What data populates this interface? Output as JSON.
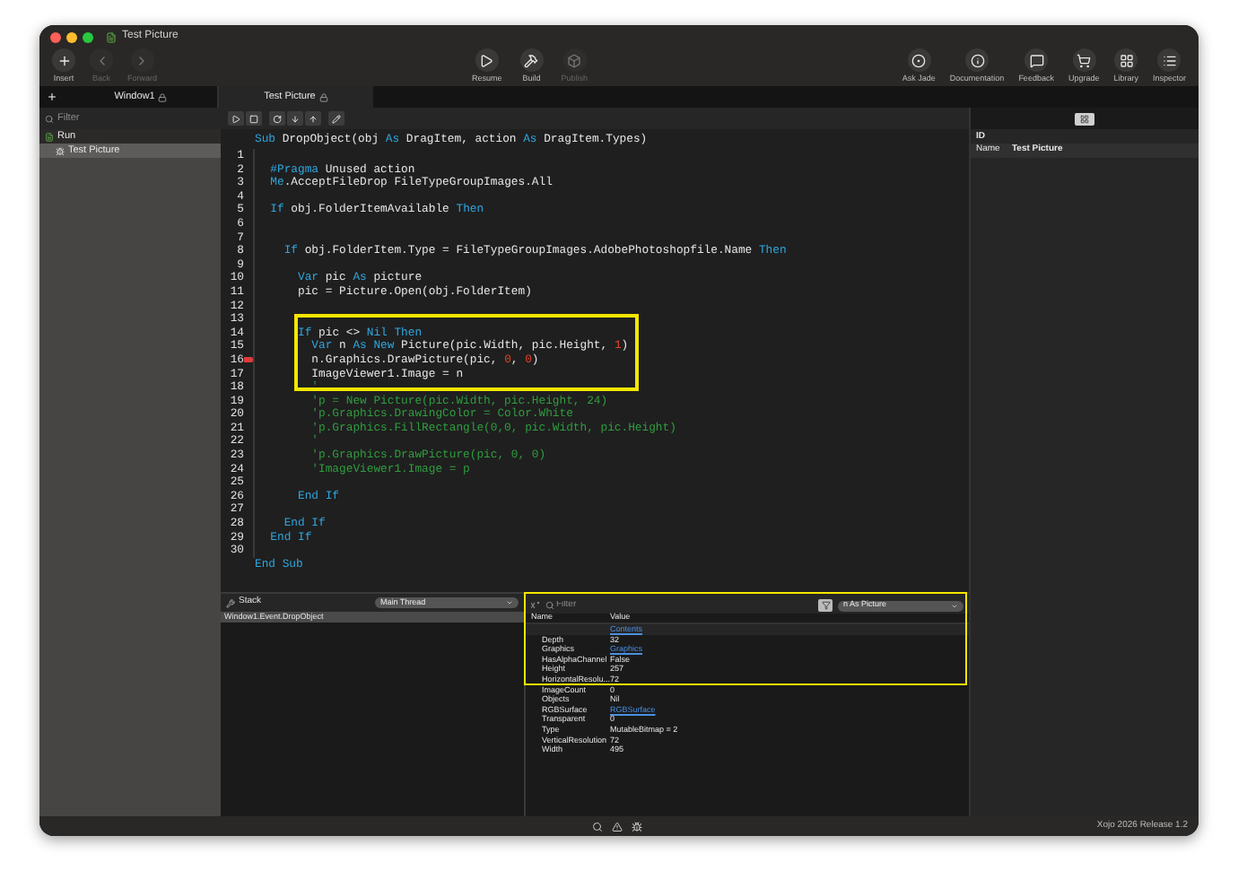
{
  "window": {
    "title": "Test Picture"
  },
  "toolbar": {
    "left": [
      {
        "label": "Insert",
        "kind": "insert",
        "disabled": false
      },
      {
        "label": "Back",
        "kind": "back",
        "disabled": true
      },
      {
        "label": "Forward",
        "kind": "forward",
        "disabled": true
      }
    ],
    "center": [
      {
        "label": "Resume",
        "kind": "resume",
        "disabled": false
      },
      {
        "label": "Build",
        "kind": "build",
        "disabled": false
      },
      {
        "label": "Publish",
        "kind": "publish",
        "disabled": true
      }
    ],
    "right": [
      {
        "label": "Ask Jade",
        "kind": "ask",
        "disabled": false
      },
      {
        "label": "Documentation",
        "kind": "docs",
        "disabled": false
      },
      {
        "label": "Feedback",
        "kind": "feedback",
        "disabled": false
      },
      {
        "label": "Upgrade",
        "kind": "upgrade",
        "disabled": false
      },
      {
        "label": "Library",
        "kind": "library",
        "disabled": false
      },
      {
        "label": "Inspector",
        "kind": "inspector",
        "disabled": false
      }
    ]
  },
  "tabs": [
    {
      "label": "Window1",
      "selected": false
    },
    {
      "label": "Test Picture",
      "selected": true
    }
  ],
  "sidebar": {
    "filter": {
      "placeholder": "Filter"
    },
    "items": [
      {
        "label": "Run",
        "selected": false,
        "children": [
          {
            "label": "Test Picture",
            "selected": true
          }
        ]
      }
    ]
  },
  "editor": {
    "header": [
      {
        "kind": "kw",
        "text": "Sub"
      },
      {
        "kind": "text",
        "text": " DropObject(obj "
      },
      {
        "kind": "kw",
        "text": "As"
      },
      {
        "kind": "text",
        "text": " DragItem, action "
      },
      {
        "kind": "kw",
        "text": "As"
      },
      {
        "kind": "text",
        "text": " DragItem.Types)"
      }
    ],
    "lines": [
      {
        "number": "1",
        "breakpoint": false
      },
      {
        "number": "2",
        "breakpoint": false,
        "segments": [
          {
            "kind": "kw",
            "text": "  #Pragma"
          },
          {
            "kind": "text",
            "text": " Unused action"
          }
        ]
      },
      {
        "number": "3",
        "breakpoint": false,
        "segments": [
          {
            "kind": "kw",
            "text": "  Me"
          },
          {
            "kind": "text",
            "text": ".AcceptFileDrop FileTypeGroupImages.All"
          }
        ]
      },
      {
        "number": "4",
        "breakpoint": false
      },
      {
        "number": "5",
        "breakpoint": false,
        "segments": [
          {
            "kind": "kw",
            "text": "  If"
          },
          {
            "kind": "text",
            "text": " obj.FolderItemAvailable "
          },
          {
            "kind": "kw",
            "text": "Then"
          }
        ]
      },
      {
        "number": "6",
        "breakpoint": false
      },
      {
        "number": "7",
        "breakpoint": false
      },
      {
        "number": "8",
        "breakpoint": false,
        "segments": [
          {
            "kind": "kw",
            "text": "    If"
          },
          {
            "kind": "text",
            "text": " obj.FolderItem.Type = FileTypeGroupImages.AdobePhotoshopfile.Name "
          },
          {
            "kind": "kw",
            "text": "Then"
          }
        ]
      },
      {
        "number": "9",
        "breakpoint": false
      },
      {
        "number": "10",
        "breakpoint": false,
        "segments": [
          {
            "kind": "kw",
            "text": "      Var"
          },
          {
            "kind": "text",
            "text": " pic "
          },
          {
            "kind": "kw",
            "text": "As"
          },
          {
            "kind": "text",
            "text": " picture"
          }
        ]
      },
      {
        "number": "11",
        "breakpoint": false,
        "segments": [
          {
            "kind": "text",
            "text": "      pic = Picture.Open(obj.FolderItem)"
          }
        ]
      },
      {
        "number": "12",
        "breakpoint": false
      },
      {
        "number": "13",
        "breakpoint": false
      },
      {
        "number": "14",
        "breakpoint": false,
        "segments": [
          {
            "kind": "kw",
            "text": "      If"
          },
          {
            "kind": "text",
            "text": " pic <> "
          },
          {
            "kind": "kw",
            "text": "Nil Then"
          }
        ]
      },
      {
        "number": "15",
        "breakpoint": false,
        "segments": [
          {
            "kind": "kw",
            "text": "        Var"
          },
          {
            "kind": "text",
            "text": " n "
          },
          {
            "kind": "kw",
            "text": "As New"
          },
          {
            "kind": "text",
            "text": " Picture(pic.Width, pic.Height, "
          },
          {
            "kind": "num",
            "text": "1"
          },
          {
            "kind": "text",
            "text": ")"
          }
        ]
      },
      {
        "number": "16",
        "breakpoint": true,
        "segments": [
          {
            "kind": "text",
            "text": "        n.Graphics.DrawPicture(pic, "
          },
          {
            "kind": "num",
            "text": "0"
          },
          {
            "kind": "text",
            "text": ", "
          },
          {
            "kind": "num",
            "text": "0"
          },
          {
            "kind": "text",
            "text": ")"
          }
        ]
      },
      {
        "number": "17",
        "breakpoint": false,
        "segments": [
          {
            "kind": "text",
            "text": "        ImageViewer1.Image = n"
          }
        ]
      },
      {
        "number": "18",
        "breakpoint": false,
        "segments": [
          {
            "kind": "comment",
            "text": "        '"
          }
        ]
      },
      {
        "number": "19",
        "breakpoint": false,
        "segments": [
          {
            "kind": "comment",
            "text": "        'p = New Picture(pic.Width, pic.Height, 24)"
          }
        ]
      },
      {
        "number": "20",
        "breakpoint": false,
        "segments": [
          {
            "kind": "comment",
            "text": "        'p.Graphics.DrawingColor = Color.White"
          }
        ]
      },
      {
        "number": "21",
        "breakpoint": false,
        "segments": [
          {
            "kind": "comment",
            "text": "        'p.Graphics.FillRectangle(0,0, pic.Width, pic.Height)"
          }
        ]
      },
      {
        "number": "22",
        "breakpoint": false,
        "segments": [
          {
            "kind": "comment",
            "text": "        '"
          }
        ]
      },
      {
        "number": "23",
        "breakpoint": false,
        "segments": [
          {
            "kind": "comment",
            "text": "        'p.Graphics.DrawPicture(pic, 0, 0)"
          }
        ]
      },
      {
        "number": "24",
        "breakpoint": false,
        "segments": [
          {
            "kind": "comment",
            "text": "        'ImageViewer1.Image = p"
          }
        ]
      },
      {
        "number": "25",
        "breakpoint": false
      },
      {
        "number": "26",
        "breakpoint": false,
        "segments": [
          {
            "kind": "kw",
            "text": "      End If"
          }
        ]
      },
      {
        "number": "27",
        "breakpoint": false
      },
      {
        "number": "28",
        "breakpoint": false,
        "segments": [
          {
            "kind": "kw",
            "text": "    End If"
          }
        ]
      },
      {
        "number": "29",
        "breakpoint": false,
        "segments": [
          {
            "kind": "kw",
            "text": "  End If"
          }
        ]
      },
      {
        "number": "30",
        "breakpoint": false
      }
    ],
    "footer": [
      {
        "kind": "kw",
        "text": "End Sub"
      }
    ]
  },
  "inspector": {
    "section": "ID",
    "properties": [
      {
        "name": "Name",
        "value": "Test Picture"
      }
    ]
  },
  "stack": {
    "title": "Stack",
    "thread": "Main Thread",
    "frames": [
      {
        "label": "Window1.Event.DropObject",
        "selected": true
      }
    ]
  },
  "variables": {
    "filter": {
      "placeholder": "Filter"
    },
    "scope": "n As Picture",
    "columns": [
      "Name",
      "Value"
    ],
    "rows": [
      {
        "value": "Contents",
        "kind": "link"
      },
      {
        "name": "Depth",
        "value": "32",
        "kind": "text"
      },
      {
        "name": "Graphics",
        "value": "Graphics",
        "kind": "link"
      },
      {
        "name": "HasAlphaChannel",
        "value": "False",
        "kind": "text"
      },
      {
        "name": "Height",
        "value": "257",
        "kind": "text"
      },
      {
        "name": "HorizontalResolu...",
        "value": "72",
        "kind": "text"
      },
      {
        "name": "ImageCount",
        "value": "0",
        "kind": "text"
      },
      {
        "name": "Objects",
        "value": "Nil",
        "kind": "text"
      },
      {
        "name": "RGBSurface",
        "value": "RGBSurface",
        "kind": "link"
      },
      {
        "name": "Transparent",
        "value": "0",
        "kind": "text"
      },
      {
        "name": "Type",
        "value": "MutableBitmap = 2",
        "kind": "text"
      },
      {
        "name": "VerticalResolution",
        "value": "72",
        "kind": "text"
      },
      {
        "name": "Width",
        "value": "495",
        "kind": "text"
      }
    ]
  },
  "status_bar": {
    "version": "Xojo 2026 Release 1.2"
  }
}
